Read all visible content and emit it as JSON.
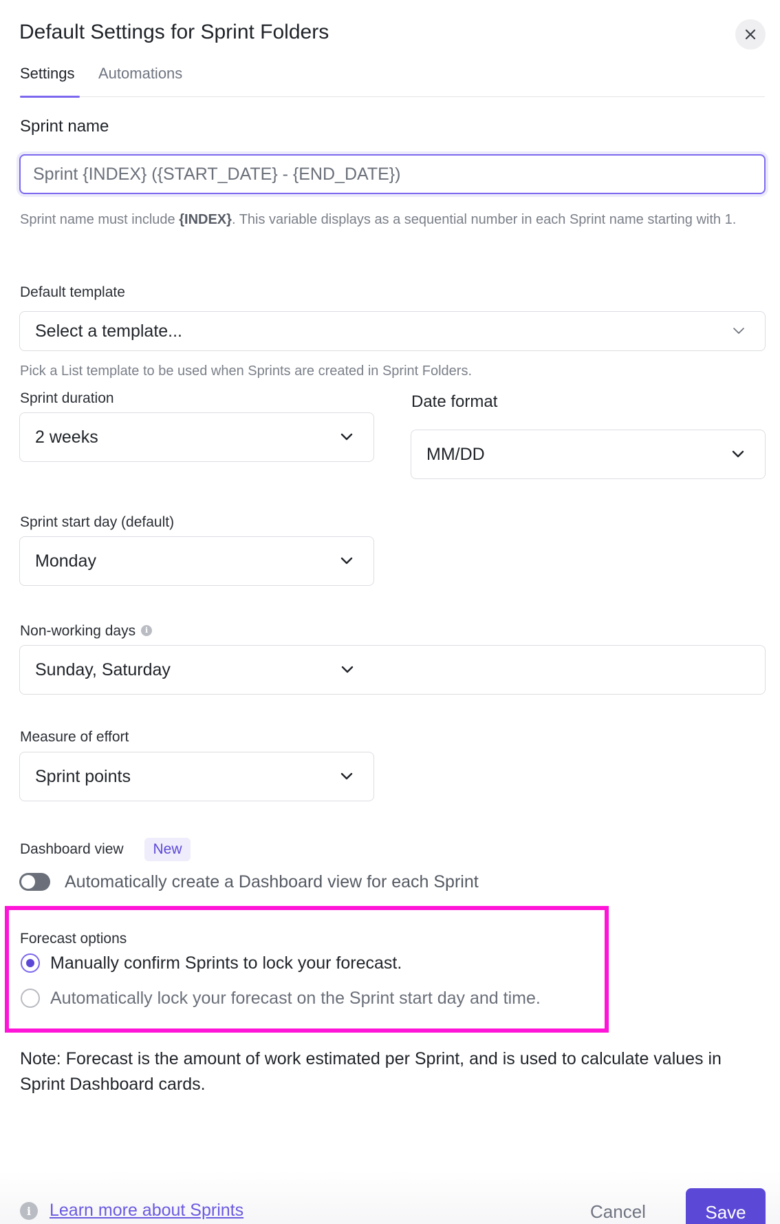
{
  "header": {
    "title": "Default Settings for Sprint Folders",
    "close_icon": "close-icon"
  },
  "tabs": [
    {
      "label": "Settings",
      "active": true
    },
    {
      "label": "Automations",
      "active": false
    }
  ],
  "sprint_name": {
    "label": "Sprint name",
    "value": "Sprint {INDEX} ({START_DATE} - {END_DATE})",
    "help_prefix": "Sprint name must include ",
    "help_bold": "{INDEX}",
    "help_suffix": ". This variable displays as a sequential number in each Sprint name starting with 1."
  },
  "default_template": {
    "label": "Default template",
    "value": "Select a template...",
    "help": "Pick a List template to be used when Sprints are created in Sprint Folders."
  },
  "sprint_duration": {
    "label": "Sprint duration",
    "value": "2 weeks"
  },
  "date_format": {
    "label": "Date format",
    "value": "MM/DD"
  },
  "sprint_start_day": {
    "label": "Sprint start day (default)",
    "value": "Monday"
  },
  "non_working_days": {
    "label": "Non-working days",
    "value": "Sunday, Saturday",
    "info_icon": "info-icon"
  },
  "measure_of_effort": {
    "label": "Measure of effort",
    "value": "Sprint points"
  },
  "dashboard_view": {
    "label": "Dashboard view",
    "badge": "New",
    "toggle_label": "Automatically create a Dashboard view for each Sprint",
    "toggle_on": false
  },
  "forecast": {
    "label": "Forecast options",
    "options": [
      {
        "label": "Manually confirm Sprints to lock your forecast.",
        "checked": true
      },
      {
        "label": "Automatically lock your forecast on the Sprint start day and time.",
        "checked": false
      }
    ],
    "highlight_color": "#ff14d8"
  },
  "note": "Note: Forecast is the amount of work estimated per Sprint, and is used to calculate values in Sprint Dashboard cards.",
  "footer": {
    "learn_more": "Learn more about Sprints",
    "cancel": "Cancel",
    "save": "Save"
  },
  "colors": {
    "accent": "#7b68ee",
    "primary_button": "#5b48d6"
  }
}
